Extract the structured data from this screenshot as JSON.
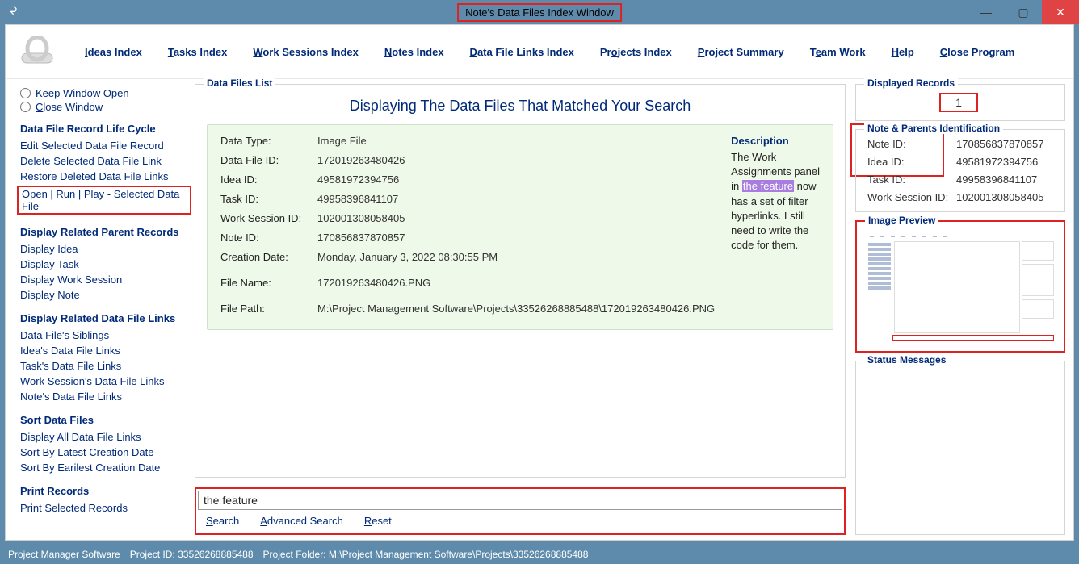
{
  "window": {
    "title": "Note's Data Files Index Window"
  },
  "menu": {
    "ideas": "Ideas Index",
    "tasks": "Tasks Index",
    "work_sessions": "Work Sessions Index",
    "notes": "Notes Index",
    "data_file_links": "Data File Links Index",
    "projects": "Projects Index",
    "project_summary": "Project Summary",
    "team_work": "Team Work",
    "help": "Help",
    "close": "Close Program"
  },
  "sidebar": {
    "radio_keep_open": "Keep Window Open",
    "radio_close": "Close Window",
    "sections": {
      "lifecycle": {
        "head": "Data File Record Life Cycle",
        "edit": "Edit Selected Data File Record",
        "delete": "Delete Selected Data File Link",
        "restore": "Restore Deleted Data File Links",
        "open_run_play": "Open | Run | Play - Selected Data File"
      },
      "parents": {
        "head": "Display Related Parent Records",
        "idea": "Display Idea",
        "task": "Display Task",
        "ws": "Display Work Session",
        "note": "Display Note"
      },
      "links": {
        "head": "Display Related Data File Links",
        "siblings": "Data File's Siblings",
        "idea": "Idea's Data File Links",
        "task": "Task's Data File Links",
        "ws": "Work Session's Data File Links",
        "note": "Note's Data File Links"
      },
      "sort": {
        "head": "Sort Data Files",
        "all": "Display All Data File Links",
        "latest": "Sort By Latest Creation Date",
        "earliest": "Sort By Earilest Creation Date"
      },
      "print": {
        "head": "Print Records",
        "selected": "Print Selected Records"
      }
    }
  },
  "list": {
    "legend": "Data Files List",
    "title": "Displaying The Data Files That Matched Your Search",
    "record": {
      "data_type_k": "Data Type:",
      "data_type_v": "Image File",
      "data_file_id_k": "Data File ID:",
      "data_file_id_v": "172019263480426",
      "idea_id_k": "Idea ID:",
      "idea_id_v": "49581972394756",
      "task_id_k": "Task ID:",
      "task_id_v": "49958396841107",
      "ws_id_k": "Work Session ID:",
      "ws_id_v": "102001308058405",
      "note_id_k": "Note ID:",
      "note_id_v": "170856837870857",
      "creation_k": "Creation Date:",
      "creation_v": "Monday, January 3, 2022   08:30:55 PM",
      "filename_k": "File Name:",
      "filename_v": "172019263480426.PNG",
      "filepath_k": "File Path:",
      "filepath_v": "M:\\Project Management Software\\Projects\\33526268885488\\172019263480426.PNG",
      "desc_head": "Description",
      "desc_before": "The Work Assignments panel in ",
      "desc_highlight": "the feature",
      "desc_after": " now has a set of filter hyperlinks. I still need to write the code for them."
    }
  },
  "search": {
    "value": "the feature",
    "search": "Search",
    "advanced": "Advanced Search",
    "reset": "Reset"
  },
  "right": {
    "displayed_legend": "Displayed Records",
    "displayed_count": "1",
    "parents_legend": "Note & Parents Identification",
    "parents": {
      "note_k": "Note ID:",
      "note_v": "170856837870857",
      "idea_k": "Idea ID:",
      "idea_v": "49581972394756",
      "task_k": "Task ID:",
      "task_v": "49958396841107",
      "ws_k": "Work Session ID:",
      "ws_v": "102001308058405"
    },
    "preview_legend": "Image Preview",
    "status_legend": "Status Messages"
  },
  "statusbar": {
    "app": "Project Manager Software",
    "project_id_label": "Project ID:",
    "project_id": "33526268885488",
    "project_folder_label": "Project Folder:",
    "project_folder": "M:\\Project Management Software\\Projects\\33526268885488"
  }
}
